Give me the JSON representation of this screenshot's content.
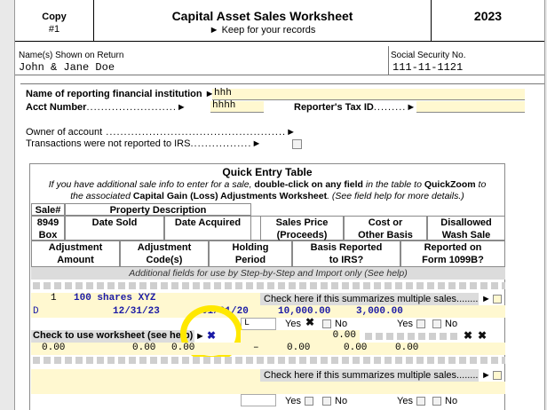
{
  "header": {
    "copy_label": "Copy",
    "copy_number": "#1",
    "title": "Capital Asset Sales Worksheet",
    "subtitle": "Keep for your records",
    "year": "2023"
  },
  "taxpayer": {
    "names_label": "Name(s) Shown on Return",
    "names_value": "John & Jane Doe",
    "ssn_label": "Social Security No.",
    "ssn_value": "111-11-1121"
  },
  "institution": {
    "name_label": "Name of reporting financial institution",
    "name_value": "hhh",
    "acct_label": "Acct Number",
    "acct_value": "hhhh",
    "tin_label": "Reporter's Tax ID",
    "tin_value": ""
  },
  "owner": {
    "owner_label": "Owner of account",
    "not_reported_label": "Transactions were not reported to IRS"
  },
  "quick_entry": {
    "title": "Quick Entry Table",
    "instr_line1_a": "If you have additional sale info to enter for a sale,",
    "instr_line1_b": "double-click on any field",
    "instr_line1_c": "in the table to",
    "instr_line1_d": "QuickZoom",
    "instr_line1_e": "to",
    "instr_line2_a": "the associated",
    "instr_line2_b": "Capital Gain (Loss) Adjustments Worksheet",
    "instr_line2_c": ". (See field help for more details.)",
    "columns": {
      "sale_no": "Sale#",
      "property_desc": "Property Description",
      "f8949_box": "8949",
      "box": "Box",
      "date_sold": "Date Sold",
      "date_acquired": "Date Acquired",
      "sales_price": "Sales  Price",
      "proceeds": "(Proceeds)",
      "cost_or": "Cost or",
      "other_basis": "Other Basis",
      "disallowed": "Disallowed",
      "wash_sale": "Wash Sale",
      "adjustment": "Adjustment",
      "amount": "Amount",
      "adj_code": "Adjustment",
      "codes": "Code(s)",
      "holding": "Holding",
      "period": "Period",
      "basis_reported": "Basis Reported",
      "to_irs": "to IRS?",
      "reported_on": "Reported on",
      "form_1099b": "Form 1099B?"
    },
    "additional_fields_note": "Additional fields for use by Step-by-Step and Import only (See help)",
    "row1": {
      "sale_no": "1",
      "description": "100 shares XYZ",
      "box": "D",
      "date_sold": "12/31/23",
      "date_acquired": "01/01/20",
      "proceeds": "10,000.00",
      "basis": "3,000.00",
      "summarize_label": "Check here if this summarizes multiple sales.........",
      "holding_value": "L",
      "yes_label": "Yes",
      "no_label": "No",
      "worksheet_label": "Check to use worksheet (see help)",
      "worksheet_amount": "0.00",
      "amt1": "0.00",
      "amt2": "0.00",
      "amt3": "0.00",
      "amt4": "0.00",
      "amt5": "0.00",
      "amt6": "0.00",
      "dash": "–"
    },
    "row2": {
      "summarize_label": "Check here if this summarizes multiple sales.........",
      "yes_label": "Yes",
      "no_label": "No"
    }
  },
  "colors": {
    "input_bg": "#fff8d0",
    "gray_bg": "#dcdcdc",
    "value_blue": "#1a1aa6",
    "highlight": "#ffe800"
  }
}
